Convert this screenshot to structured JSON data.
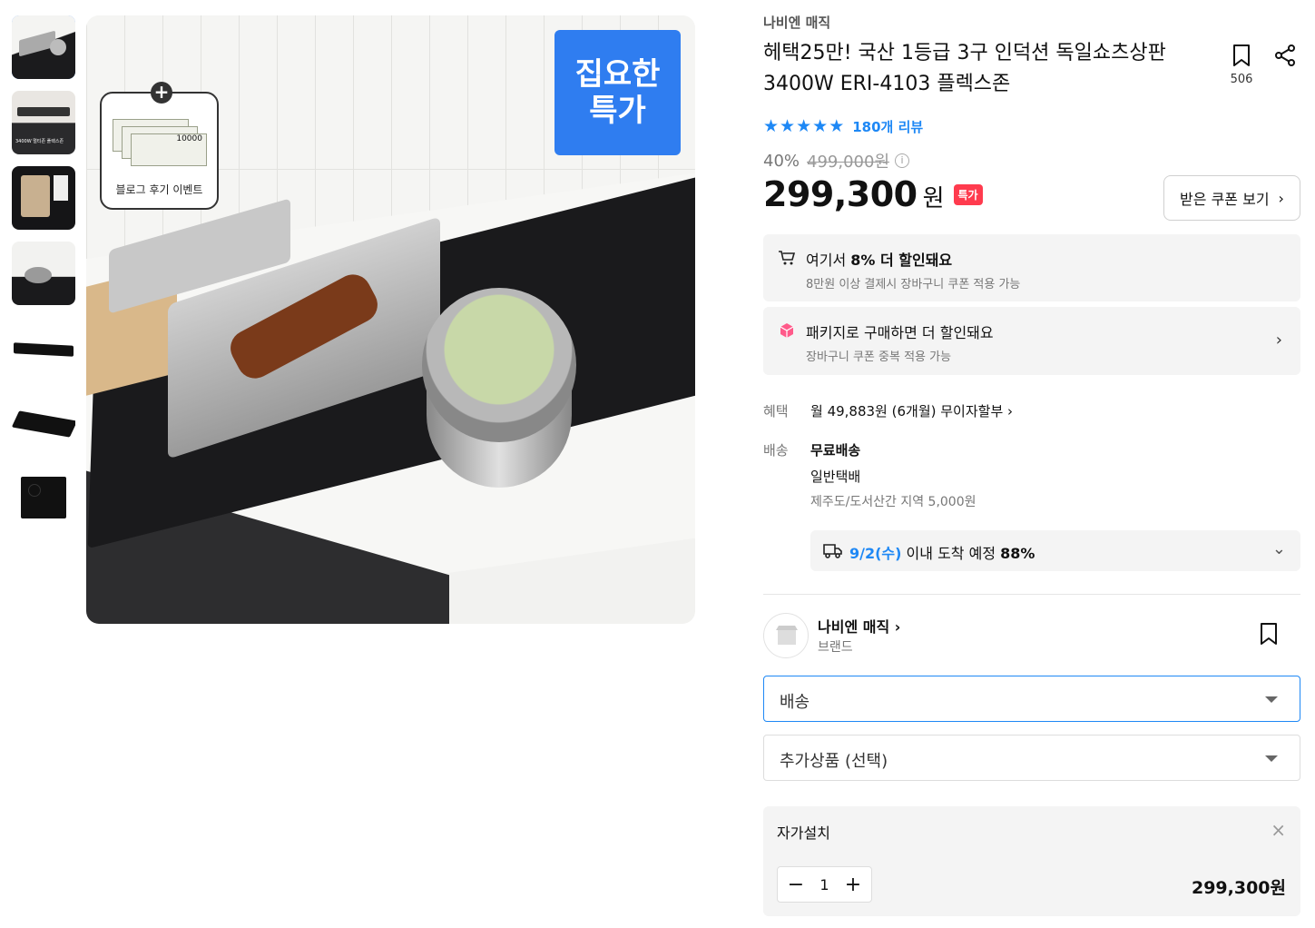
{
  "gallery": {
    "thumbnails": [
      "thumb-1",
      "thumb-2",
      "thumb-3",
      "thumb-4",
      "thumb-5",
      "thumb-6",
      "thumb-7"
    ],
    "thumb2_caption": "3400W 멀티존 플렉스존",
    "badge_line1": "집요한",
    "badge_line2": "특가",
    "event_label": "블로그 후기 이벤트",
    "bill_value": "10000"
  },
  "product": {
    "brand": "나비엔 매직",
    "title": "헤택25만! 국산 1등급 3구 인덕션 독일쇼츠상판 3400W ERI-4103 플렉스존",
    "bookmark_count": "506",
    "rating_stars": 5,
    "reviews": "180개 리뷰",
    "discount_rate": "40%",
    "original_price": "499,000원",
    "price": "299,300",
    "price_unit": "원",
    "special_tag": "특가",
    "coupon_button": "받은 쿠폰 보기"
  },
  "promos": [
    {
      "main_prefix": "여기서 ",
      "main_bold": "8% 더 할인돼요",
      "sub": "8만원 이상 결제시 장바구니 쿠폰 적용 가능"
    },
    {
      "main": "패키지로 구매하면 더 할인돼요",
      "sub": "장바구니 쿠폰 중복 적용 가능"
    }
  ],
  "benefit": {
    "label": "혜택",
    "value": "월 49,883원 (6개월) 무이자할부"
  },
  "shipping": {
    "label": "배송",
    "line1": "무료배송",
    "line2": "일반택배",
    "line3": "제주도/도서산간 지역 5,000원",
    "arrival_date": "9/2(수)",
    "arrival_text": " 이내 도착 예정 ",
    "arrival_rate": "88%"
  },
  "store": {
    "name": "나비엔 매직",
    "sub": "브랜드"
  },
  "selects": {
    "shipping_value": "배송",
    "addon_value": "추가상품 (선택)"
  },
  "selected_option": {
    "name": "자가설치",
    "quantity": "1",
    "price": "299,300원"
  },
  "colors": {
    "accent": "#1e88f5",
    "special_red": "#ff3b4e",
    "badge_blue": "#2f7df0"
  }
}
